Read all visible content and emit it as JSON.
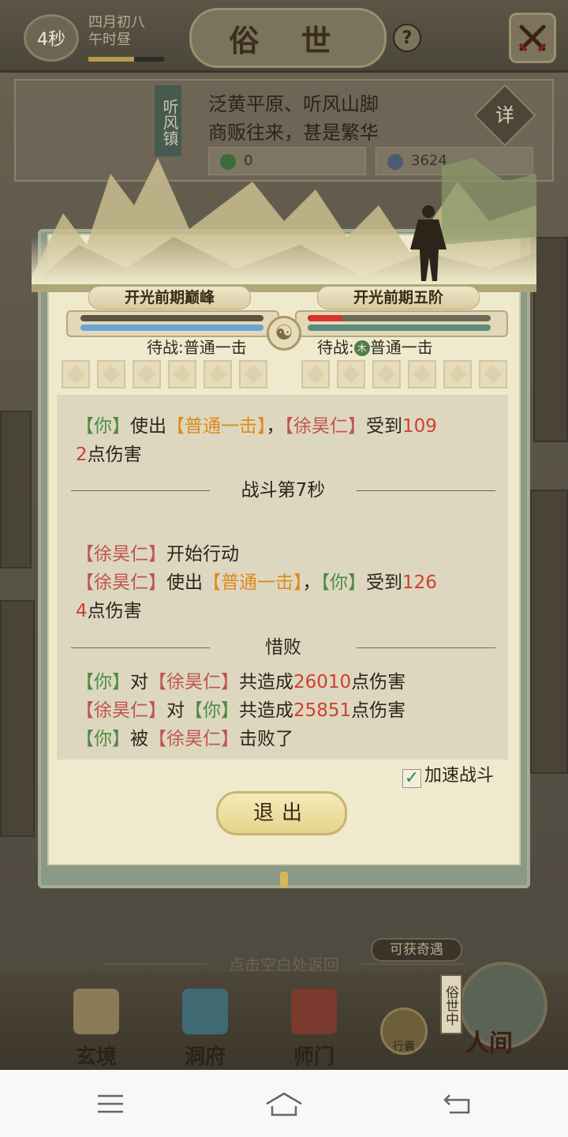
{
  "header": {
    "timer": "4秒",
    "date_line1": "四月初八",
    "date_line2": "午时昼",
    "title": "俗 世",
    "help_label": "?",
    "close_icon": "crossed-swords-icon"
  },
  "location": {
    "name": "听风镇",
    "desc_line1": "泛黄平原、听风山脚",
    "desc_line2": "商贩往来，甚是繁华",
    "detail_label": "详",
    "res1": "0",
    "res2": "3624"
  },
  "battle": {
    "player_realm": "开光前期巅峰",
    "enemy_realm": "开光前期五阶",
    "player_status": "待战:普通一击",
    "enemy_status_prefix": "待战:",
    "enemy_element": "木",
    "enemy_status_skill": "普通一击",
    "player_hp_fraction": 1.0,
    "enemy_hp_fraction": 0.19,
    "colors": {
      "player_hp": "#5a5440",
      "player_mp": "#6aa4d6",
      "enemy_hp": "#d8322a",
      "enemy_mp": "#5b8a7f"
    },
    "log": {
      "l1_a": "【你】",
      "l1_b": "使出",
      "l1_c": "【普通一击】",
      "l1_d": "，",
      "l1_e": "【徐昊仁】",
      "l1_f": "受到",
      "l1_g": "109",
      "l2_a": "2",
      "l2_b": "点伤害",
      "sec_label": "战斗第7秒",
      "l3_a": "【徐昊仁】",
      "l3_b": "开始行动",
      "l4_a": "【徐昊仁】",
      "l4_b": "使出",
      "l4_c": "【普通一击】",
      "l4_d": "，",
      "l4_e": "【你】",
      "l4_f": "受到",
      "l4_g": "126",
      "l5_a": "4",
      "l5_b": "点伤害",
      "result_label": "惜败",
      "s1_a": "【你】",
      "s1_b": "对",
      "s1_c": "【徐昊仁】",
      "s1_d": "共造成",
      "s1_e": "26010",
      "s1_f": "点伤害",
      "s2_a": "【徐昊仁】",
      "s2_b": "对",
      "s2_c": "【你】",
      "s2_d": "共造成",
      "s2_e": "25851",
      "s2_f": "点伤害",
      "s3_a": "【你】",
      "s3_b": "被",
      "s3_c": "【徐昊仁】",
      "s3_d": "击败了"
    },
    "speedup_label": "加速战斗",
    "speedup_checked": true,
    "exit_label": "退出"
  },
  "footer": {
    "hint": "点击空白处返回",
    "reward_tag": "可获奇遇",
    "worldly_status": "俗世中",
    "bag_label": "行囊",
    "nav": [
      {
        "label": "玄境"
      },
      {
        "label": "洞府"
      },
      {
        "label": "师门"
      },
      {
        "label": "人间"
      }
    ]
  }
}
